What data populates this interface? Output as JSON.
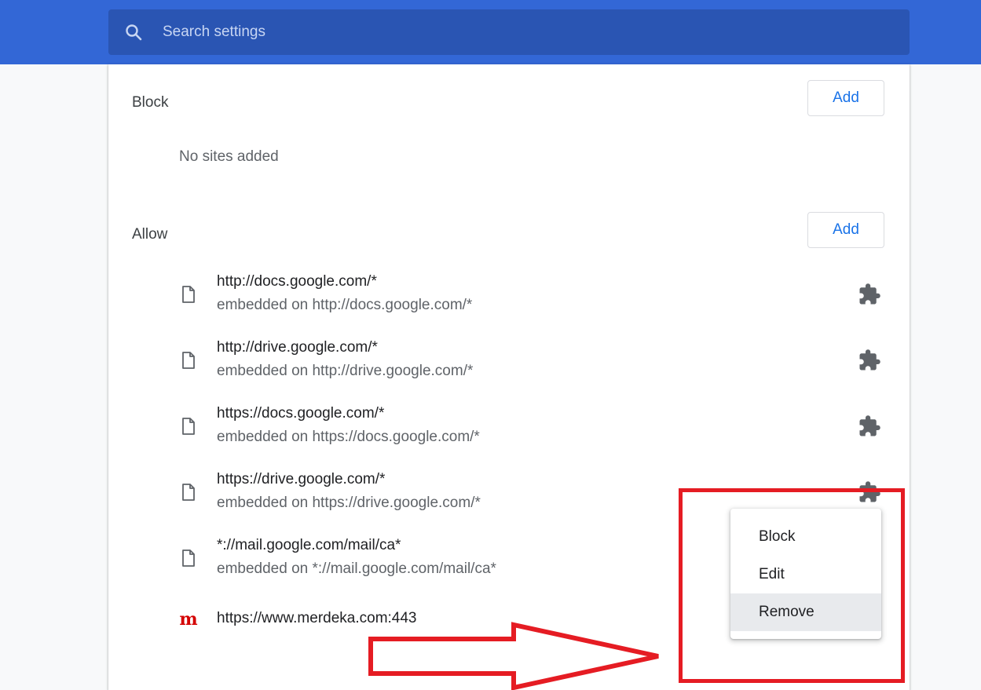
{
  "search": {
    "placeholder": "Search settings"
  },
  "block": {
    "title": "Block",
    "add_label": "Add",
    "empty_text": "No sites added"
  },
  "allow": {
    "title": "Allow",
    "add_label": "Add",
    "sites": [
      {
        "url": "http://docs.google.com/*",
        "sub": "embedded on http://docs.google.com/*"
      },
      {
        "url": "http://drive.google.com/*",
        "sub": "embedded on http://drive.google.com/*"
      },
      {
        "url": "https://docs.google.com/*",
        "sub": "embedded on https://docs.google.com/*"
      },
      {
        "url": "https://drive.google.com/*",
        "sub": "embedded on https://drive.google.com/*"
      },
      {
        "url": "*://mail.google.com/mail/ca*",
        "sub": "embedded on *://mail.google.com/mail/ca*"
      },
      {
        "url": "https://www.merdeka.com:443",
        "logo": "m"
      }
    ]
  },
  "context_menu": {
    "items": [
      {
        "label": "Block"
      },
      {
        "label": "Edit"
      },
      {
        "label": "Remove",
        "highlighted": true
      }
    ]
  },
  "colors": {
    "header": "#3367d6",
    "accent": "#1a73e8",
    "annotation": "#e51c23"
  }
}
